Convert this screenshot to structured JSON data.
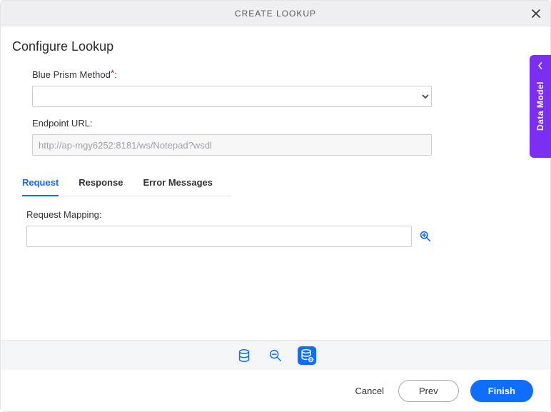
{
  "dialog": {
    "title": "CREATE LOOKUP"
  },
  "section": {
    "heading": "Configure Lookup"
  },
  "form": {
    "method_label": "Blue Prism Method",
    "method_value": "",
    "endpoint_label": "Endpoint URL:",
    "endpoint_value": "http://ap-mgy6252:8181/ws/Notepad?wsdl"
  },
  "tabs": {
    "items": [
      {
        "label": "Request",
        "active": true
      },
      {
        "label": "Response",
        "active": false
      },
      {
        "label": "Error Messages",
        "active": false
      }
    ]
  },
  "mapping": {
    "label": "Request Mapping:",
    "value": ""
  },
  "side_panel": {
    "label": "Data Model"
  },
  "footer": {
    "cancel_label": "Cancel",
    "prev_label": "Prev",
    "finish_label": "Finish"
  },
  "colors": {
    "primary": "#0f6dff",
    "accent_purple": "#7b2ff2",
    "required": "#d83b01"
  }
}
